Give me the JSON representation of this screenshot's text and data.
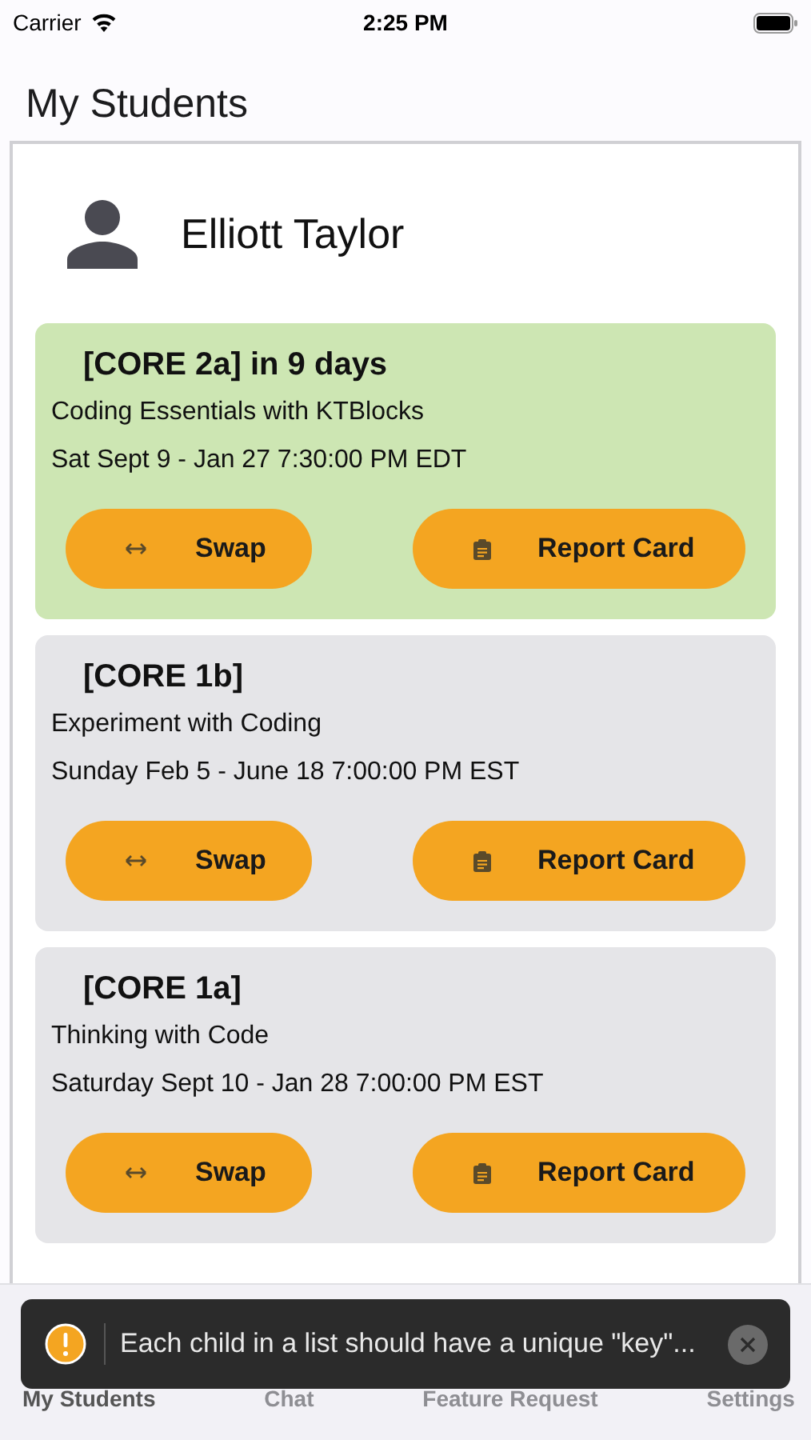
{
  "status_bar": {
    "carrier": "Carrier",
    "time": "2:25 PM"
  },
  "header": {
    "title": "My Students"
  },
  "student": {
    "name": "Elliott Taylor"
  },
  "courses": [
    {
      "title": "[CORE 2a] in 9 days",
      "subtitle": "Coding Essentials with KTBlocks",
      "schedule": "Sat Sept 9 - Jan 27 7:30:00 PM EDT",
      "upcoming": true,
      "buttons": [
        {
          "kind": "swap",
          "label": "Swap"
        },
        {
          "kind": "report",
          "label": "Report Card"
        }
      ]
    },
    {
      "title": "[CORE 1b]",
      "subtitle": "Experiment with Coding",
      "schedule": "Sunday Feb 5 - June 18 7:00:00 PM EST",
      "upcoming": false,
      "buttons": [
        {
          "kind": "swap",
          "label": "Swap"
        },
        {
          "kind": "report",
          "label": "Report Card"
        }
      ]
    },
    {
      "title": "[CORE 1a]",
      "subtitle": "Thinking with Code",
      "schedule": "Saturday Sept 10 - Jan 28 7:00:00 PM EST",
      "upcoming": false,
      "buttons": [
        {
          "kind": "swap",
          "label": "Swap"
        },
        {
          "kind": "report",
          "label": "Report Card"
        }
      ]
    }
  ],
  "tab_bar": [
    {
      "label": "My Students",
      "selected": true
    },
    {
      "label": "Chat",
      "selected": false
    },
    {
      "label": "Feature Request",
      "selected": false
    },
    {
      "label": "Settings",
      "selected": false
    }
  ],
  "toast": {
    "message": "Each child in a list should have a unique \"key\"..."
  }
}
